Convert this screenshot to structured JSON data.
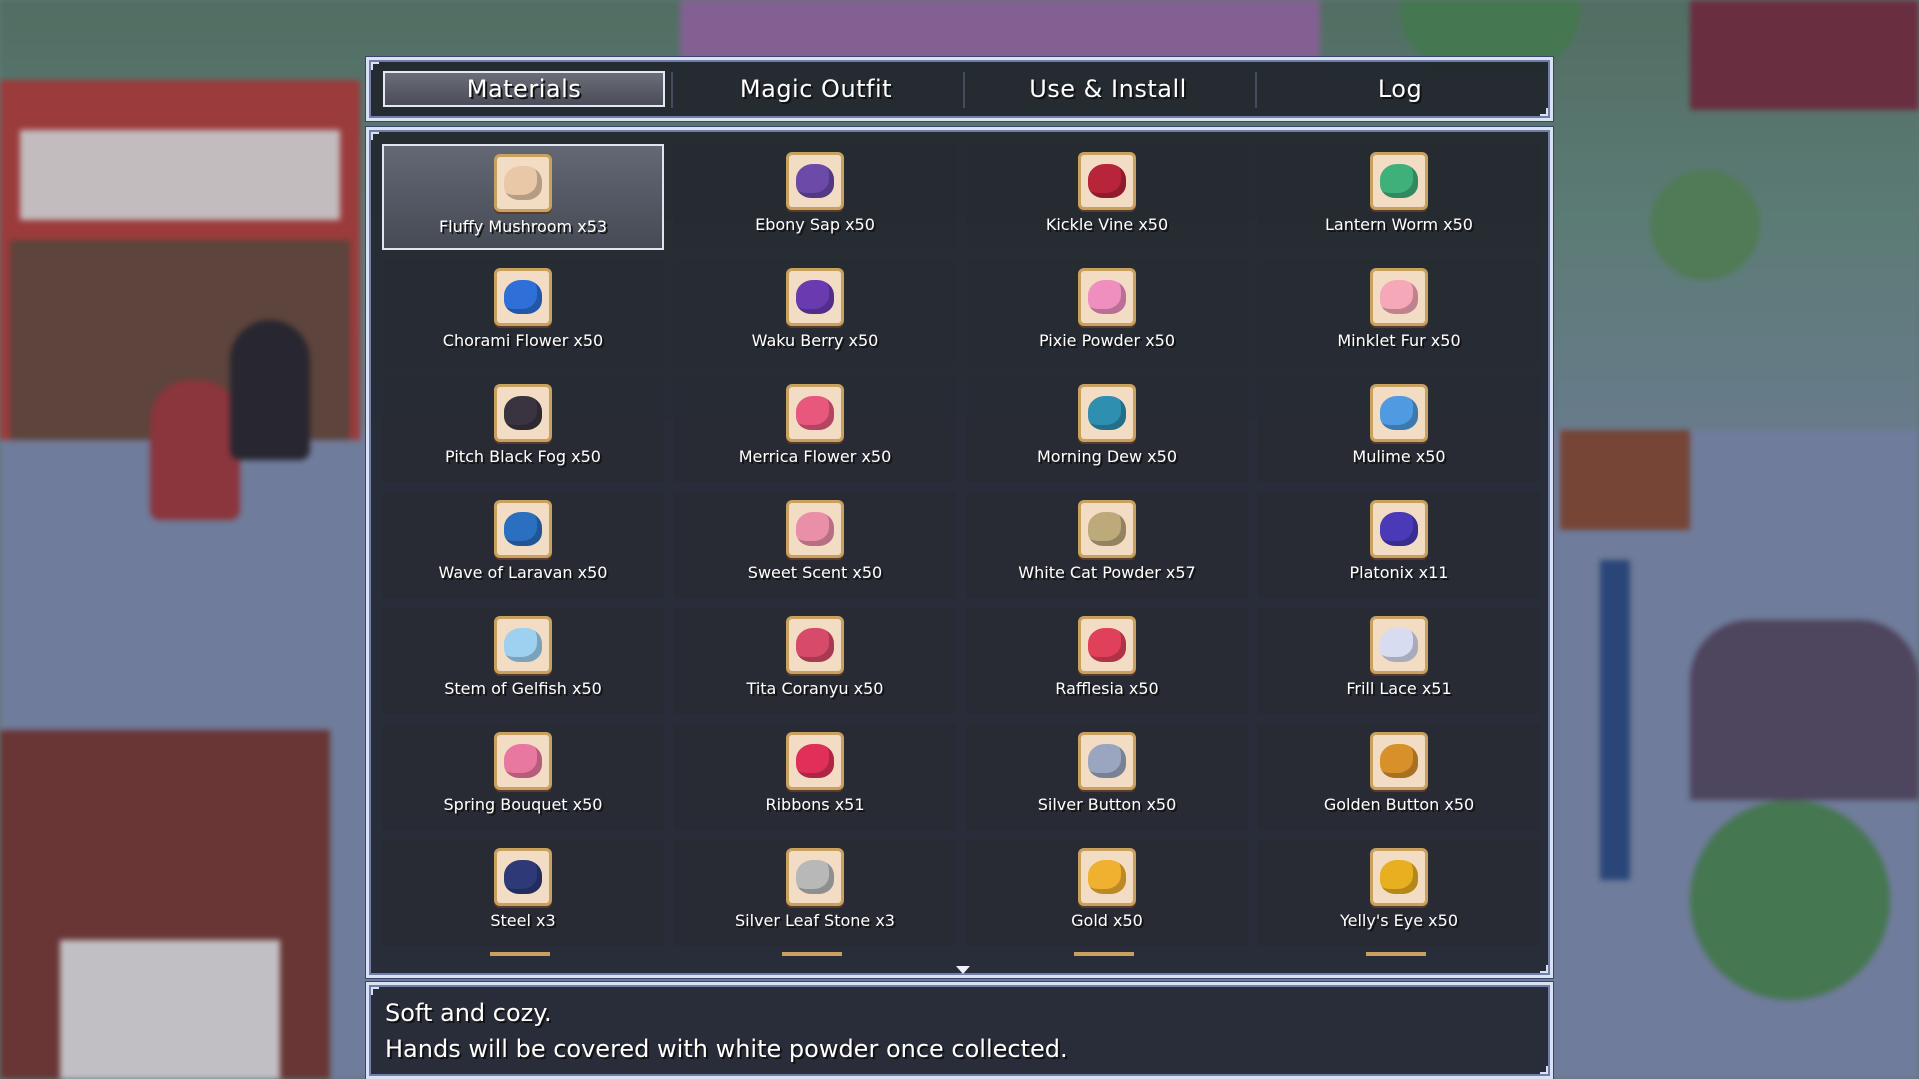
{
  "tabs": [
    {
      "label": "Materials",
      "active": true
    },
    {
      "label": "Magic Outfit",
      "active": false
    },
    {
      "label": "Use & Install",
      "active": false
    },
    {
      "label": "Log",
      "active": false
    }
  ],
  "items": [
    {
      "label": "Fluffy Mushroom x53",
      "icon": "fluffy-mushroom-icon",
      "color": "#e9c8a8",
      "selected": true
    },
    {
      "label": "Ebony Sap x50",
      "icon": "ebony-sap-icon",
      "color": "#6b4aa8"
    },
    {
      "label": "Kickle Vine x50",
      "icon": "kickle-vine-icon",
      "color": "#b8243a"
    },
    {
      "label": "Lantern Worm x50",
      "icon": "lantern-worm-icon",
      "color": "#3fb07a"
    },
    {
      "label": "Chorami Flower x50",
      "icon": "chorami-flower-icon",
      "color": "#2f6fd8"
    },
    {
      "label": "Waku Berry x50",
      "icon": "waku-berry-icon",
      "color": "#6a3bb0"
    },
    {
      "label": "Pixie Powder x50",
      "icon": "pixie-powder-icon",
      "color": "#ef8fc0"
    },
    {
      "label": "Minklet Fur x50",
      "icon": "minklet-fur-icon",
      "color": "#f4a8b8"
    },
    {
      "label": "Pitch Black Fog x50",
      "icon": "pitch-black-fog-icon",
      "color": "#3a3440"
    },
    {
      "label": "Merrica Flower x50",
      "icon": "merrica-flower-icon",
      "color": "#e8577e"
    },
    {
      "label": "Morning Dew x50",
      "icon": "morning-dew-icon",
      "color": "#2e8fb0"
    },
    {
      "label": "Mulime x50",
      "icon": "mulime-icon",
      "color": "#4f9ae0"
    },
    {
      "label": "Wave of Laravan x50",
      "icon": "wave-of-laravan-icon",
      "color": "#2a6fc0"
    },
    {
      "label": "Sweet Scent x50",
      "icon": "sweet-scent-icon",
      "color": "#e98fa8"
    },
    {
      "label": "White Cat Powder x57",
      "icon": "white-cat-powder-icon",
      "color": "#bdaa7a"
    },
    {
      "label": "Platonix x11",
      "icon": "platonix-icon",
      "color": "#4a3ab8"
    },
    {
      "label": "Stem of Gelfish x50",
      "icon": "stem-of-gelfish-icon",
      "color": "#9ed0f0"
    },
    {
      "label": "Tita Coranyu x50",
      "icon": "tita-coranyu-icon",
      "color": "#d84a6a"
    },
    {
      "label": "Rafflesia x50",
      "icon": "rafflesia-icon",
      "color": "#e0405a"
    },
    {
      "label": "Frill Lace x51",
      "icon": "frill-lace-icon",
      "color": "#d8dcf0"
    },
    {
      "label": "Spring Bouquet x50",
      "icon": "spring-bouquet-icon",
      "color": "#e878a0"
    },
    {
      "label": "Ribbons x51",
      "icon": "ribbons-icon",
      "color": "#e0305a"
    },
    {
      "label": "Silver Button x50",
      "icon": "silver-button-icon",
      "color": "#9aa6c0"
    },
    {
      "label": "Golden Button x50",
      "icon": "golden-button-icon",
      "color": "#d8902a"
    },
    {
      "label": "Steel x3",
      "icon": "steel-icon",
      "color": "#2e3a78"
    },
    {
      "label": "Silver Leaf Stone x3",
      "icon": "silver-leaf-stone-icon",
      "color": "#b8b8b8"
    },
    {
      "label": "Gold x50",
      "icon": "gold-icon",
      "color": "#f0b030"
    },
    {
      "label": "Yelly's Eye x50",
      "icon": "yellys-eye-icon",
      "color": "#e8b020"
    }
  ],
  "description": {
    "line1": "Soft and cozy.",
    "line2": "Hands will be covered with white powder once collected."
  }
}
